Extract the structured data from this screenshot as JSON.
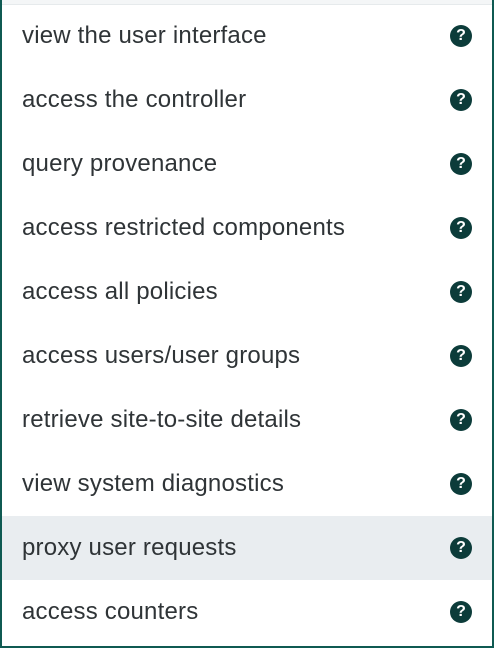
{
  "policies": {
    "items": [
      {
        "label": "view the user interface",
        "help_icon": "question-circle-icon",
        "glyph": "?"
      },
      {
        "label": "access the controller",
        "help_icon": "question-circle-icon",
        "glyph": "?"
      },
      {
        "label": "query provenance",
        "help_icon": "question-circle-icon",
        "glyph": "?"
      },
      {
        "label": "access restricted components",
        "help_icon": "question-circle-icon",
        "glyph": "?"
      },
      {
        "label": "access all policies",
        "help_icon": "question-circle-icon",
        "glyph": "?"
      },
      {
        "label": "access users/user groups",
        "help_icon": "question-circle-icon",
        "glyph": "?"
      },
      {
        "label": "retrieve site-to-site details",
        "help_icon": "question-circle-icon",
        "glyph": "?"
      },
      {
        "label": "view system diagnostics",
        "help_icon": "question-circle-icon",
        "glyph": "?"
      },
      {
        "label": "proxy user requests",
        "help_icon": "question-circle-icon",
        "glyph": "?",
        "highlighted": true
      },
      {
        "label": "access counters",
        "help_icon": "question-circle-icon",
        "glyph": "?"
      }
    ]
  },
  "colors": {
    "border": "#0f5a52",
    "icon_bg": "#0c3c3a",
    "highlight_bg": "#e9edf0",
    "text": "#2f3437"
  }
}
